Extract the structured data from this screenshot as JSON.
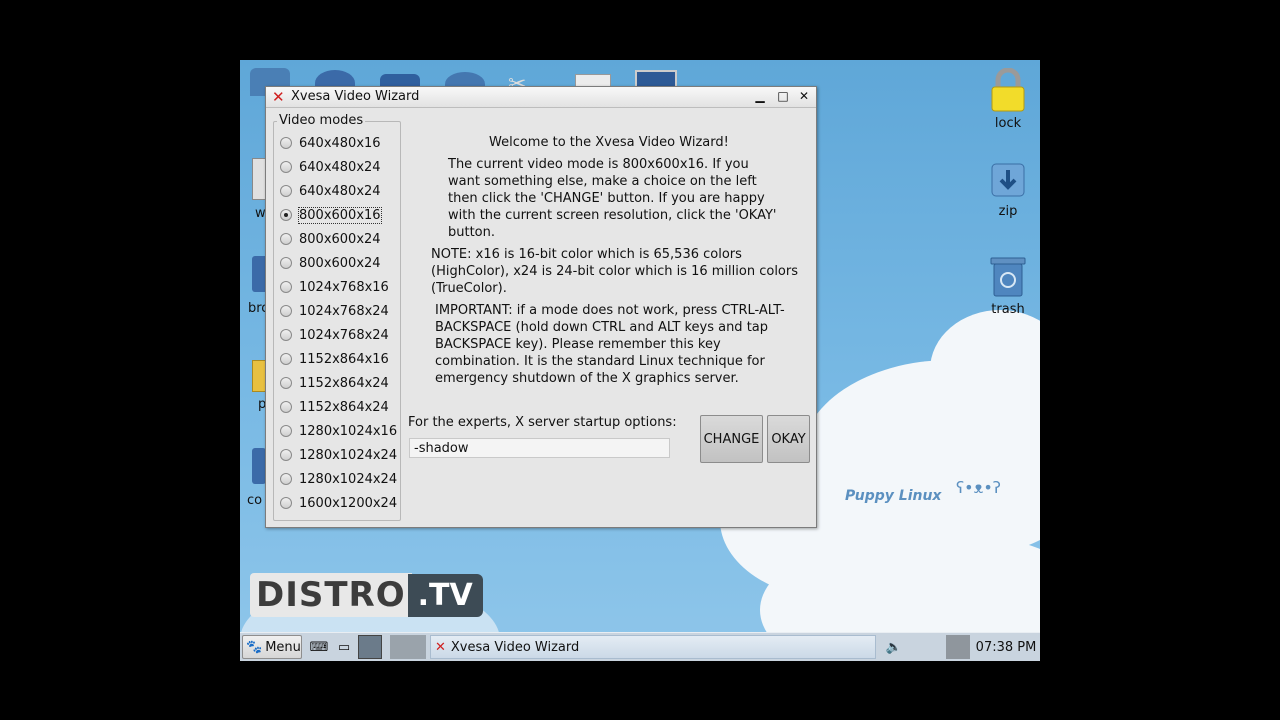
{
  "desktop": {
    "icons_right": [
      {
        "label": "lock",
        "icon": "padlock-icon"
      },
      {
        "label": "zip",
        "icon": "zip-drive-icon"
      },
      {
        "label": "trash",
        "icon": "trash-icon"
      }
    ],
    "partial_left_labels": [
      "w",
      "bro",
      "p",
      "co"
    ],
    "watermark": "Puppy Linux",
    "distro_logo": {
      "left": "DISTRO",
      "right": ".TV"
    }
  },
  "window": {
    "title": "Xvesa Video Wizard",
    "controls": [
      "minimize",
      "maximize",
      "close"
    ],
    "video_modes": {
      "legend": "Video modes",
      "options": [
        "640x480x16",
        "640x480x24",
        "640x480x24",
        "800x600x16",
        "800x600x24",
        "800x600x24",
        "1024x768x16",
        "1024x768x24",
        "1024x768x24",
        "1152x864x16",
        "1152x864x24",
        "1152x864x24",
        "1280x1024x16",
        "1280x1024x24",
        "1280x1024x24",
        "1600x1200x24"
      ],
      "selected_index": 3
    },
    "welcome": "Welcome to the Xvesa Video Wizard!",
    "current_lines": [
      "The current video mode is 800x600x16. If you",
      "want something else, make a choice on the left",
      "then click the 'CHANGE' button. If you are happy",
      "with the current screen resolution, click the 'OKAY'",
      "button."
    ],
    "note_lines": [
      "NOTE: x16 is 16-bit color which is 65,536 colors",
      "(HighColor), x24 is 24-bit color which is 16 million colors",
      "(TrueColor)."
    ],
    "important_lines": [
      "IMPORTANT: if a mode does not work, press CTRL-ALT-",
      "BACKSPACE (hold down CTRL and ALT keys and tap",
      "BACKSPACE key). Please remember this key",
      "combination. It is the standard Linux technique for",
      "emergency shutdown of the X graphics server."
    ],
    "experts_label": "For the experts, X server startup options:",
    "experts_value": "-shadow",
    "change_label": "CHANGE",
    "okay_label": "OKAY"
  },
  "taskbar": {
    "menu_label": "Menu",
    "task_label": "Xvesa Video Wizard",
    "clock": "07:38 PM"
  },
  "colors": {
    "desktop_sky": "#78b9e4",
    "window_bg": "#e6e6e6",
    "taskbar": "#c9d4df",
    "close_x": "#d02020"
  }
}
